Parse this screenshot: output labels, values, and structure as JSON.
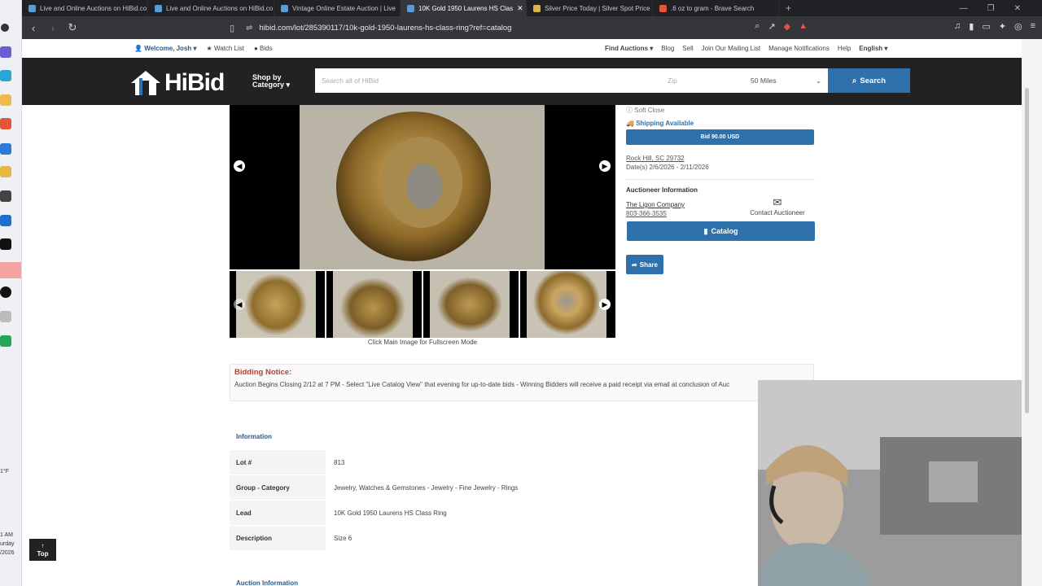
{
  "browser": {
    "tabs": [
      {
        "title": "Live and Online Auctions on HiBid.co",
        "active": false,
        "favicon_color": "#5b9bd5"
      },
      {
        "title": "Live and Online Auctions on HiBid.co",
        "active": false,
        "favicon_color": "#5b9bd5"
      },
      {
        "title": "Vintage Online Estate Auction | Live",
        "active": false,
        "favicon_color": "#5b9bd5"
      },
      {
        "title": "10K Gold 1950 Laurens HS Clas",
        "active": true,
        "favicon_color": "#5b9bd5"
      },
      {
        "title": "Silver Price Today | Silver Spot Price",
        "active": false,
        "favicon_color": "#d9b44a"
      },
      {
        "title": ".6 oz to gram - Brave Search",
        "active": false,
        "favicon_color": "#e2573b"
      }
    ],
    "url": "hibid.com/lot/285390117/10k-gold-1950-laurens-hs-class-ring?ref=catalog"
  },
  "topnav": {
    "welcome": "Welcome, Josh",
    "watch_list": "Watch List",
    "bids": "Bids",
    "find_auctions": "Find Auctions",
    "blog": "Blog",
    "sell": "Sell",
    "mailing_list": "Join Our Mailing List",
    "notifications": "Manage Notifications",
    "help": "Help",
    "language": "English"
  },
  "header": {
    "logo": "HiBid",
    "shop_by_line1": "Shop by",
    "shop_by_line2": "Category",
    "search_placeholder": "Search all of HiBid",
    "zip_placeholder": "Zip",
    "miles": "50 Miles",
    "search_button": "Search"
  },
  "gallery": {
    "caption": "Click Main Image for Fullscreen Mode"
  },
  "side": {
    "soft_close": "Soft Close",
    "shipping": "Shipping Available",
    "bid_button": "Bid 90.00 USD",
    "location": "Rock Hill, SC 29732",
    "dates": "Date(s) 2/6/2026 - 2/11/2026",
    "auctioneer_title": "Auctioneer Information",
    "company": "The Ligon Company",
    "phone": "803-366-3535",
    "contact": "Contact Auctioneer",
    "catalog_button": "Catalog",
    "share_button": "Share"
  },
  "notice": {
    "title": "Bidding Notice:",
    "body": "Auction Begins Closing 2/12 at 7 PM - Select \"Live Catalog View\" that evening for up-to-date bids - Winning Bidders will receive a paid receipt via email at conclusion of Auc"
  },
  "info": {
    "heading": "Information",
    "rows": [
      {
        "key": "Lot #",
        "value": "813"
      },
      {
        "key": "Group - Category",
        "value": "Jewelry, Watches & Gemstones - Jewelry - Fine Jewelry - Rings"
      },
      {
        "key": "Lead",
        "value": "10K Gold 1950 Laurens HS Class Ring"
      },
      {
        "key": "Description",
        "value": "Size 6"
      }
    ],
    "auction_info": "Auction Information"
  },
  "top_button": "Top",
  "os": {
    "temp": "1°F",
    "time": "1 AM",
    "day": "urday",
    "year": "/2026"
  },
  "colors": {
    "brand_blue": "#2f71ad",
    "header_dark": "#222222",
    "notice_red": "#c0392b"
  }
}
